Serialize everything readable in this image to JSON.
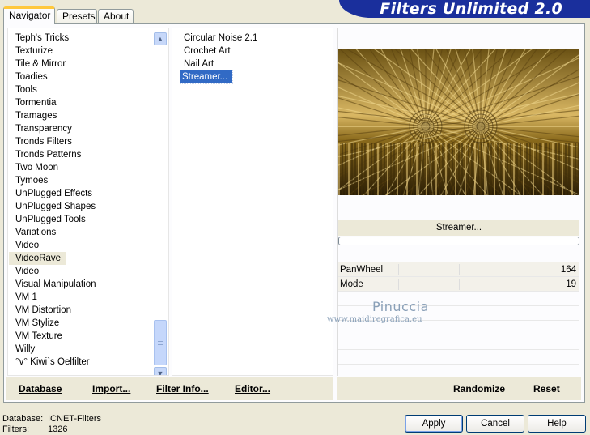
{
  "app": {
    "title": "Filters Unlimited 2.0"
  },
  "tabs": [
    {
      "label": "Navigator",
      "active": true
    },
    {
      "label": "Presets",
      "active": false
    },
    {
      "label": "About",
      "active": false
    }
  ],
  "categories": [
    "Teph's Tricks",
    "Texturize",
    "Tile & Mirror",
    "Toadies",
    "Tools",
    "Tormentia",
    "Tramages",
    "Transparency",
    "Tronds Filters",
    "Tronds Patterns",
    "Two Moon",
    "Tymoes",
    "UnPlugged Effects",
    "UnPlugged Shapes",
    "UnPlugged Tools",
    "Variations",
    "Video",
    "VideoRave",
    "Video",
    "Visual Manipulation",
    "VM 1",
    "VM Distortion",
    "VM Stylize",
    "VM Texture",
    "Willy",
    "°v° Kiwi`s Oelfilter"
  ],
  "selected_category": "VideoRave",
  "filters": [
    "Circular Noise 2.1",
    "Crochet Art",
    "Nail Art",
    "Streamer..."
  ],
  "selected_filter": "Streamer...",
  "filter_name": "Streamer...",
  "params": [
    {
      "name": "PanWheel",
      "value": "164"
    },
    {
      "name": "Mode",
      "value": "19"
    }
  ],
  "watermark": {
    "name": "Pinuccia",
    "url": "www.maidiregrafica.eu"
  },
  "left_buttons": {
    "database": "Database",
    "import": "Import...",
    "filter_info": "Filter Info...",
    "editor": "Editor..."
  },
  "right_buttons": {
    "randomize": "Randomize",
    "reset": "Reset"
  },
  "status": {
    "database_label": "Database:",
    "database_value": "ICNET-Filters",
    "filters_label": "Filters:",
    "filters_value": "1326"
  },
  "dialog_buttons": {
    "apply": "Apply",
    "cancel": "Cancel",
    "help": "Help"
  },
  "colors": {
    "banner": "#1a2f9c",
    "selection": "#316ac5",
    "preview_gold": "#c9a23a"
  }
}
